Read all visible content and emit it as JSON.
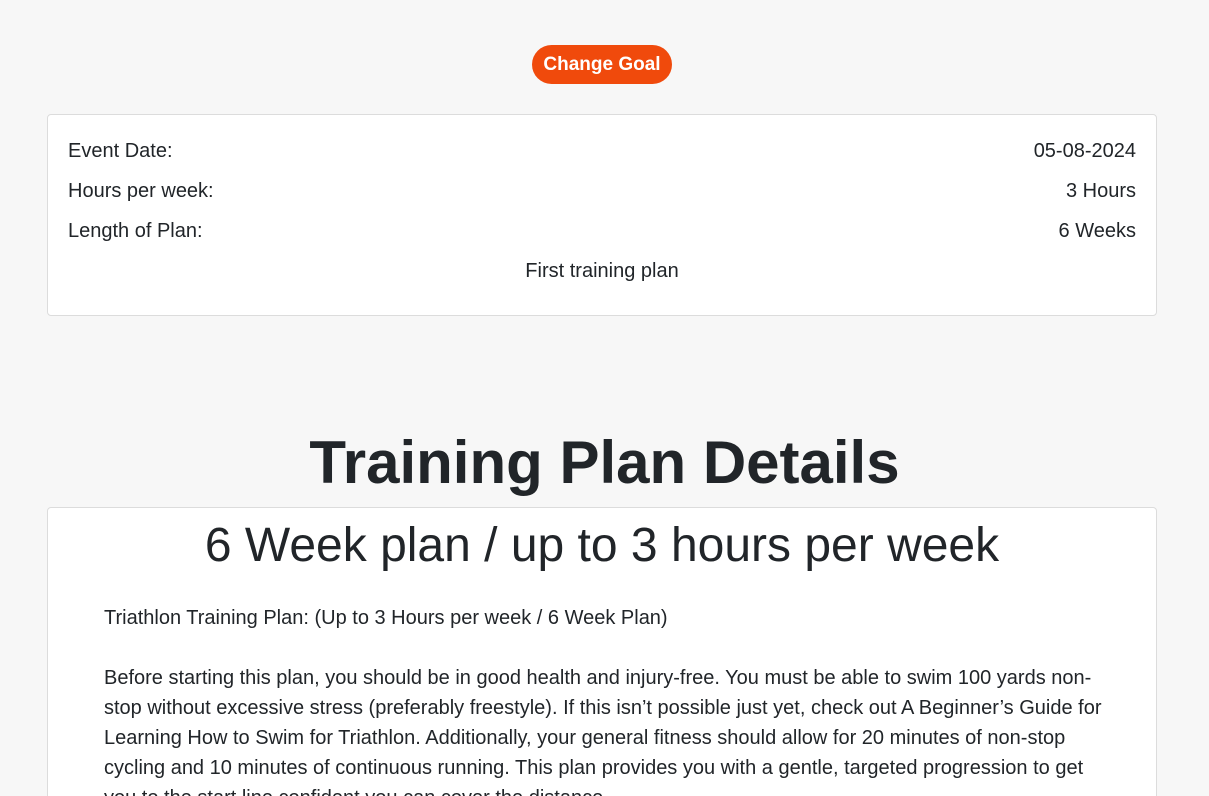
{
  "goal": {
    "change_label": "Change Goal"
  },
  "summary": {
    "event_date_label": "Event Date:",
    "event_date_value": "05-08-2024",
    "hours_label": "Hours per week:",
    "hours_value": "3 Hours",
    "length_label": "Length of Plan:",
    "length_value": "6 Weeks",
    "plan_name": "First training plan"
  },
  "details": {
    "section_title": "Training Plan Details",
    "heading": "6 Week plan / up to 3 hours per week",
    "subtitle": "Triathlon Training Plan: (Up to 3 Hours per week / 6 Week Plan)",
    "body": "Before starting this plan, you should be in good health and injury-free. You must be able to swim 100 yards non-stop without excessive stress (preferably freestyle). If this isn’t possible just yet, check out A Beginner’s Guide for Learning How to Swim for Triathlon. Additionally, your general fitness should allow for 20 minutes of non-stop cycling and 10 minutes of continuous running. This plan provides you with a gentle, targeted progression to get you to the start line confident you can cover the distance."
  },
  "colors": {
    "accent": "#f04a0c",
    "background": "#f7f7f7",
    "card": "#ffffff",
    "text": "#212529"
  }
}
